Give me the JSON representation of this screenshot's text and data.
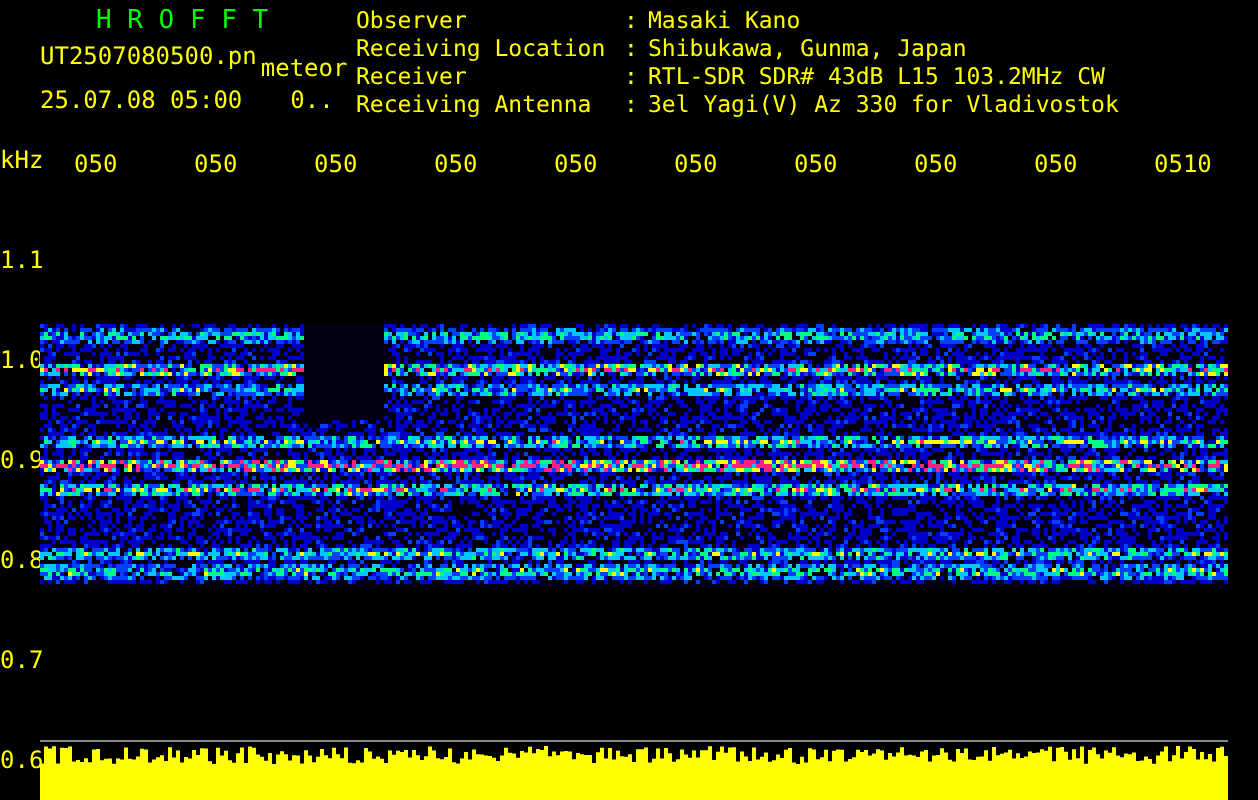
{
  "app_title": "H R O F F T",
  "file": {
    "name": "UT2507080500.pn",
    "tag": "meteor"
  },
  "timestamp": "25.07.08 05:00",
  "count": "0..",
  "info": [
    {
      "label": "Observer",
      "sep": ":",
      "value": "Masaki Kano"
    },
    {
      "label": "Receiving Location",
      "sep": ":",
      "value": "Shibukawa, Gunma, Japan"
    },
    {
      "label": "Receiver",
      "sep": ":",
      "value": "RTL-SDR SDR# 43dB L15 103.2MHz CW"
    },
    {
      "label": "Receiving Antenna",
      "sep": ":",
      "value": "3el Yagi(V) Az 330 for Vladivostok"
    }
  ],
  "y_axis": {
    "unit": "kHz",
    "labels": [
      "1.1",
      "1.0",
      "0.9",
      "0.8",
      "0.7",
      "0.6"
    ]
  },
  "time_labels": [
    "050",
    "050",
    "050",
    "050",
    "050",
    "050",
    "050",
    "050",
    "050",
    "0510"
  ]
}
